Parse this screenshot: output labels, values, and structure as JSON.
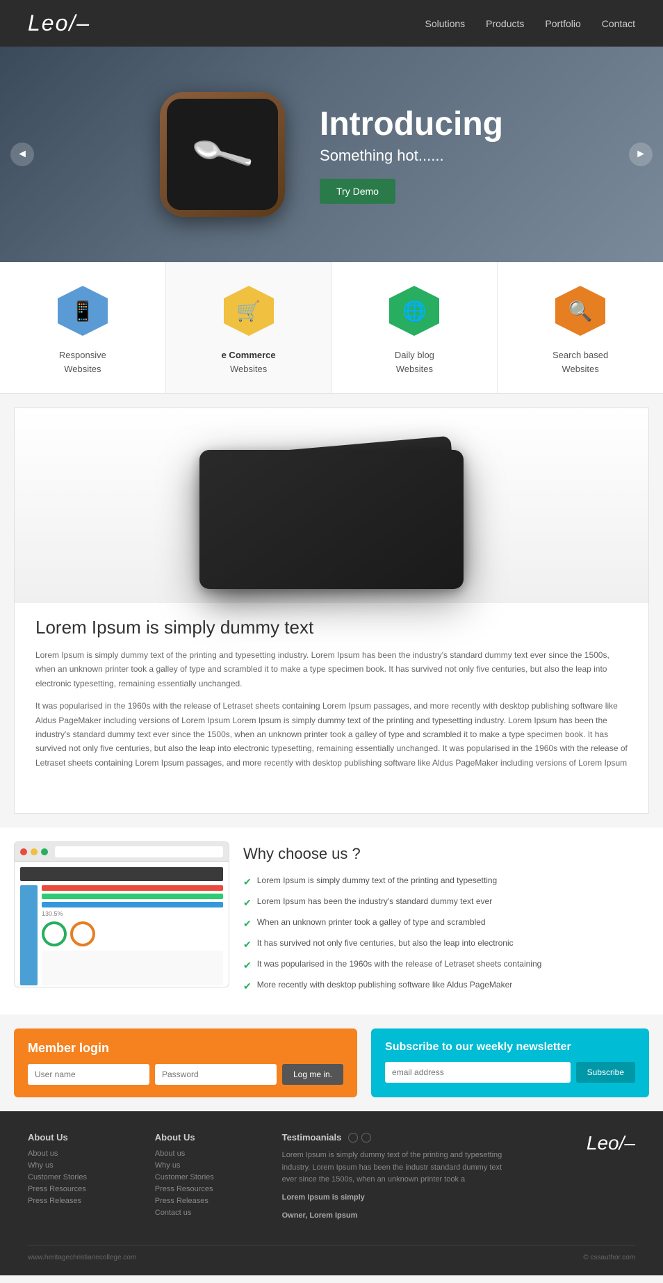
{
  "header": {
    "logo": "Leo/–",
    "nav": [
      {
        "label": "Solutions",
        "href": "#"
      },
      {
        "label": "Products",
        "href": "#"
      },
      {
        "label": "Portfolio",
        "href": "#"
      },
      {
        "label": "Contact",
        "href": "#"
      }
    ]
  },
  "hero": {
    "title": "Introducing",
    "subtitle": "Something hot......",
    "cta": "Try Demo",
    "prev": "◄",
    "next": "►"
  },
  "features": [
    {
      "id": "responsive",
      "icon": "📱",
      "color": "#5b9bd5",
      "label": "Responsive",
      "sublabel": "Websites"
    },
    {
      "id": "ecommerce",
      "icon": "🛒",
      "color": "#f0c040",
      "label": "e Commerce",
      "sublabel": "Websites",
      "active": true
    },
    {
      "id": "blog",
      "icon": "🌐",
      "color": "#27ae60",
      "label": "Daily blog",
      "sublabel": "Websites"
    },
    {
      "id": "search",
      "icon": "🔍",
      "color": "#e67e22",
      "label": "Search based",
      "sublabel": "Websites"
    }
  ],
  "content": {
    "heading": "Lorem Ipsum is simply dummy text",
    "para1": "Lorem Ipsum is simply dummy text of the printing and typesetting industry. Lorem Ipsum has been the industry's standard dummy text ever since the 1500s, when an unknown printer took a galley of type and scrambled it to make a type specimen book. It has survived not only five centuries, but also the leap into electronic typesetting, remaining essentially unchanged.",
    "para2": "It was popularised in the 1960s with the release of Letraset sheets containing Lorem Ipsum passages, and more recently with desktop publishing software like Aldus PageMaker including versions of Lorem Ipsum Lorem Ipsum is simply dummy text of the printing and typesetting industry. Lorem Ipsum has been the industry's standard dummy text ever since the 1500s, when an unknown printer took a galley of type and scrambled it to make a type specimen book. It has survived not only five centuries, but also the leap into electronic typesetting, remaining essentially unchanged. It was popularised in the 1960s with the release of Letraset sheets containing Lorem Ipsum passages, and more recently with desktop publishing software like Aldus PageMaker including versions of Lorem Ipsum"
  },
  "why": {
    "heading": "Why choose us ?",
    "list": [
      "Lorem Ipsum is simply dummy text of the printing and typesetting",
      "Lorem Ipsum has been the industry's standard dummy text ever",
      "When an unknown printer took a galley of type and scrambled",
      "It has survived not only five centuries, but also the leap into electronic",
      "It was popularised in the 1960s with the release of Letraset sheets containing",
      "More recently with desktop publishing software like Aldus PageMaker"
    ]
  },
  "member": {
    "title": "Member login",
    "username_placeholder": "User name",
    "password_placeholder": "Password",
    "button": "Log me in."
  },
  "newsletter": {
    "title": "Subscribe to our weekly newsletter",
    "email_placeholder": "email address",
    "button": "Subscribe"
  },
  "footer": {
    "logo": "Leo/–",
    "copyright_left": "www.heritagechristianecollege.com",
    "copyright_right": "© cssauthor.com",
    "col1": {
      "heading": "About Us",
      "links": [
        "About us",
        "Why us",
        "Customer Stories",
        "Press Resources",
        "Press Releases"
      ]
    },
    "col2": {
      "heading": "About Us",
      "links": [
        "About us",
        "Why us",
        "Customer Stories",
        "Press Resources",
        "Press Releases",
        "Contact us"
      ]
    },
    "testimonials": {
      "heading": "Testimoanials",
      "text": "Lorem Ipsum is simply dummy text of the printing and typesetting industry. Lorem Ipsum has been the industr standard dummy text ever since the 1500s, when an unknown printer took a",
      "author_bold": "Lorem Ipsum is simply",
      "author_title": "Owner, Lorem Ipsum"
    }
  }
}
